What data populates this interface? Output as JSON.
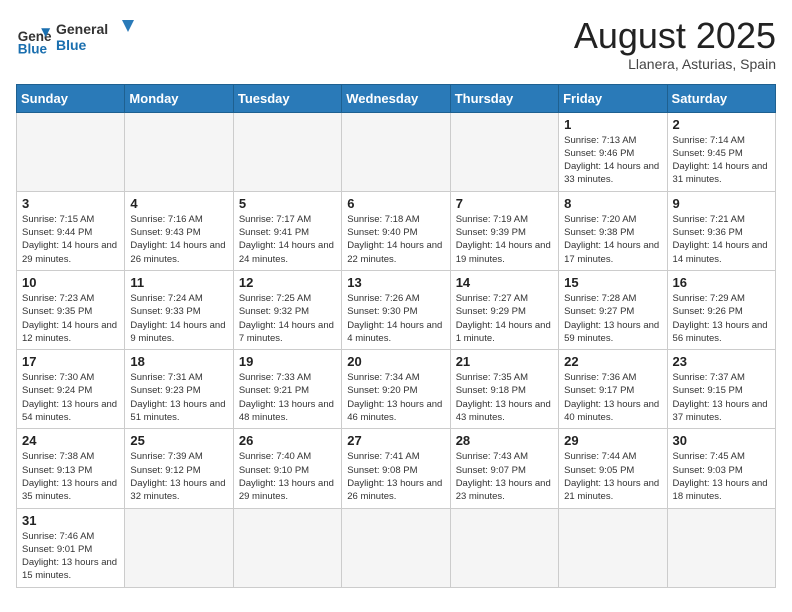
{
  "header": {
    "logo_general": "General",
    "logo_blue": "Blue",
    "month_year": "August 2025",
    "location": "Llanera, Asturias, Spain"
  },
  "weekdays": [
    "Sunday",
    "Monday",
    "Tuesday",
    "Wednesday",
    "Thursday",
    "Friday",
    "Saturday"
  ],
  "weeks": [
    [
      {
        "day": "",
        "info": ""
      },
      {
        "day": "",
        "info": ""
      },
      {
        "day": "",
        "info": ""
      },
      {
        "day": "",
        "info": ""
      },
      {
        "day": "",
        "info": ""
      },
      {
        "day": "1",
        "info": "Sunrise: 7:13 AM\nSunset: 9:46 PM\nDaylight: 14 hours and 33 minutes."
      },
      {
        "day": "2",
        "info": "Sunrise: 7:14 AM\nSunset: 9:45 PM\nDaylight: 14 hours and 31 minutes."
      }
    ],
    [
      {
        "day": "3",
        "info": "Sunrise: 7:15 AM\nSunset: 9:44 PM\nDaylight: 14 hours and 29 minutes."
      },
      {
        "day": "4",
        "info": "Sunrise: 7:16 AM\nSunset: 9:43 PM\nDaylight: 14 hours and 26 minutes."
      },
      {
        "day": "5",
        "info": "Sunrise: 7:17 AM\nSunset: 9:41 PM\nDaylight: 14 hours and 24 minutes."
      },
      {
        "day": "6",
        "info": "Sunrise: 7:18 AM\nSunset: 9:40 PM\nDaylight: 14 hours and 22 minutes."
      },
      {
        "day": "7",
        "info": "Sunrise: 7:19 AM\nSunset: 9:39 PM\nDaylight: 14 hours and 19 minutes."
      },
      {
        "day": "8",
        "info": "Sunrise: 7:20 AM\nSunset: 9:38 PM\nDaylight: 14 hours and 17 minutes."
      },
      {
        "day": "9",
        "info": "Sunrise: 7:21 AM\nSunset: 9:36 PM\nDaylight: 14 hours and 14 minutes."
      }
    ],
    [
      {
        "day": "10",
        "info": "Sunrise: 7:23 AM\nSunset: 9:35 PM\nDaylight: 14 hours and 12 minutes."
      },
      {
        "day": "11",
        "info": "Sunrise: 7:24 AM\nSunset: 9:33 PM\nDaylight: 14 hours and 9 minutes."
      },
      {
        "day": "12",
        "info": "Sunrise: 7:25 AM\nSunset: 9:32 PM\nDaylight: 14 hours and 7 minutes."
      },
      {
        "day": "13",
        "info": "Sunrise: 7:26 AM\nSunset: 9:30 PM\nDaylight: 14 hours and 4 minutes."
      },
      {
        "day": "14",
        "info": "Sunrise: 7:27 AM\nSunset: 9:29 PM\nDaylight: 14 hours and 1 minute."
      },
      {
        "day": "15",
        "info": "Sunrise: 7:28 AM\nSunset: 9:27 PM\nDaylight: 13 hours and 59 minutes."
      },
      {
        "day": "16",
        "info": "Sunrise: 7:29 AM\nSunset: 9:26 PM\nDaylight: 13 hours and 56 minutes."
      }
    ],
    [
      {
        "day": "17",
        "info": "Sunrise: 7:30 AM\nSunset: 9:24 PM\nDaylight: 13 hours and 54 minutes."
      },
      {
        "day": "18",
        "info": "Sunrise: 7:31 AM\nSunset: 9:23 PM\nDaylight: 13 hours and 51 minutes."
      },
      {
        "day": "19",
        "info": "Sunrise: 7:33 AM\nSunset: 9:21 PM\nDaylight: 13 hours and 48 minutes."
      },
      {
        "day": "20",
        "info": "Sunrise: 7:34 AM\nSunset: 9:20 PM\nDaylight: 13 hours and 46 minutes."
      },
      {
        "day": "21",
        "info": "Sunrise: 7:35 AM\nSunset: 9:18 PM\nDaylight: 13 hours and 43 minutes."
      },
      {
        "day": "22",
        "info": "Sunrise: 7:36 AM\nSunset: 9:17 PM\nDaylight: 13 hours and 40 minutes."
      },
      {
        "day": "23",
        "info": "Sunrise: 7:37 AM\nSunset: 9:15 PM\nDaylight: 13 hours and 37 minutes."
      }
    ],
    [
      {
        "day": "24",
        "info": "Sunrise: 7:38 AM\nSunset: 9:13 PM\nDaylight: 13 hours and 35 minutes."
      },
      {
        "day": "25",
        "info": "Sunrise: 7:39 AM\nSunset: 9:12 PM\nDaylight: 13 hours and 32 minutes."
      },
      {
        "day": "26",
        "info": "Sunrise: 7:40 AM\nSunset: 9:10 PM\nDaylight: 13 hours and 29 minutes."
      },
      {
        "day": "27",
        "info": "Sunrise: 7:41 AM\nSunset: 9:08 PM\nDaylight: 13 hours and 26 minutes."
      },
      {
        "day": "28",
        "info": "Sunrise: 7:43 AM\nSunset: 9:07 PM\nDaylight: 13 hours and 23 minutes."
      },
      {
        "day": "29",
        "info": "Sunrise: 7:44 AM\nSunset: 9:05 PM\nDaylight: 13 hours and 21 minutes."
      },
      {
        "day": "30",
        "info": "Sunrise: 7:45 AM\nSunset: 9:03 PM\nDaylight: 13 hours and 18 minutes."
      }
    ],
    [
      {
        "day": "31",
        "info": "Sunrise: 7:46 AM\nSunset: 9:01 PM\nDaylight: 13 hours and 15 minutes."
      },
      {
        "day": "",
        "info": ""
      },
      {
        "day": "",
        "info": ""
      },
      {
        "day": "",
        "info": ""
      },
      {
        "day": "",
        "info": ""
      },
      {
        "day": "",
        "info": ""
      },
      {
        "day": "",
        "info": ""
      }
    ]
  ]
}
